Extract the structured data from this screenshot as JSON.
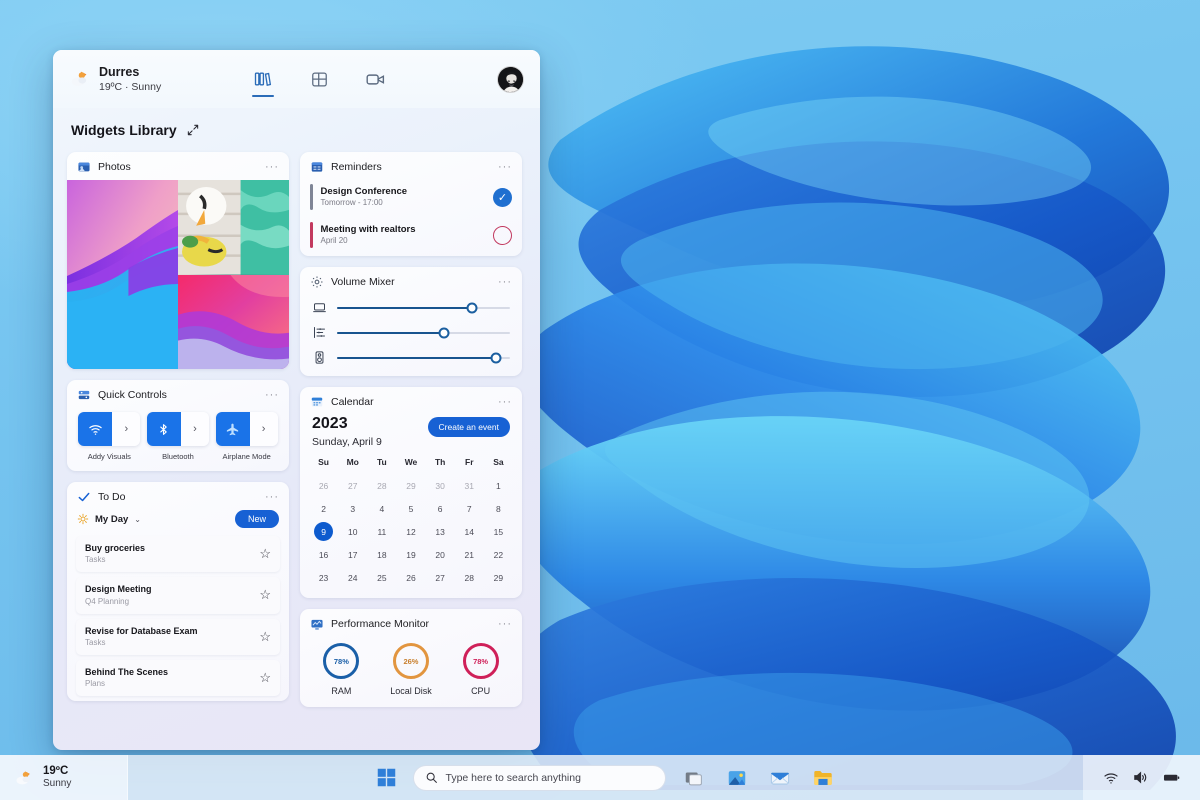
{
  "desktop": {
    "wallpaper_name": "windows-11-bloom-wallpaper"
  },
  "panel": {
    "header": {
      "weather_icon": "sun-behind-cloud-icon",
      "city": "Durres",
      "condition": "19ºC · Sunny",
      "icons": [
        {
          "name": "library-icon",
          "label": "Library",
          "active": true
        },
        {
          "name": "widgets-grid-icon",
          "label": "Widgets",
          "active": false
        },
        {
          "name": "video-camera-icon",
          "label": "Video",
          "active": false
        }
      ],
      "avatar_name": "user-avatar"
    },
    "library": {
      "title": "Widgets Library",
      "expand_icon": "expand-diagonal-icon"
    },
    "widgets": {
      "photos": {
        "icon": "photos-icon",
        "title": "Photos",
        "menu": "···",
        "cells": [
          {
            "name": "photo-tile-1"
          },
          {
            "name": "photo-tile-2"
          },
          {
            "name": "photo-tile-3"
          }
        ]
      },
      "reminders": {
        "icon": "reminders-icon",
        "title": "Reminders",
        "menu": "···",
        "items": [
          {
            "title": "Design Conference",
            "sub": "Tomorrow - 17:00",
            "bar_color": "#7f8596",
            "state": "done",
            "check_glyph": "✓"
          },
          {
            "title": "Meeting with realtors",
            "sub": "April 20",
            "bar_color": "#c2395f",
            "state": "open",
            "check_glyph": ""
          }
        ]
      },
      "volume_mixer": {
        "icon": "volume-mixer-icon",
        "title": "Volume Mixer",
        "menu": "···",
        "sliders": [
          {
            "name": "device-volume-slider",
            "icon": "laptop-icon",
            "value": 78
          },
          {
            "name": "app-volume-slider",
            "icon": "equalizer-icon",
            "value": 62
          },
          {
            "name": "media-volume-slider",
            "icon": "media-device-icon",
            "value": 92
          }
        ]
      },
      "quick_controls": {
        "icon": "quick-controls-icon",
        "title": "Quick Controls",
        "menu": "···",
        "toggles": [
          {
            "name": "wifi-toggle",
            "icon": "wifi-icon",
            "label": "Addy Visuals",
            "arrow": "›"
          },
          {
            "name": "bluetooth-toggle",
            "icon": "bluetooth-icon",
            "label": "Bluetooth",
            "arrow": "›"
          },
          {
            "name": "airplane-toggle",
            "icon": "airplane-icon",
            "label": "Airplane Mode",
            "arrow": "›"
          }
        ]
      },
      "todo": {
        "icon": "checkmark-icon",
        "title": "To Do",
        "menu": "···",
        "list_icon": "sun-icon",
        "list_name": "My Day",
        "chevron": "⌄",
        "new_button": "New",
        "items": [
          {
            "title": "Buy groceries",
            "sub": "Tasks",
            "star": "☆"
          },
          {
            "title": "Design Meeting",
            "sub": "Q4 Planning",
            "star": "☆"
          },
          {
            "title": "Revise for Database Exam",
            "sub": "Tasks",
            "star": "☆"
          },
          {
            "title": "Behind The Scenes",
            "sub": "Plans",
            "star": "☆"
          }
        ]
      },
      "calendar": {
        "icon": "calendar-icon",
        "title": "Calendar",
        "menu": "···",
        "year": "2023",
        "date": "Sunday, April 9",
        "create_button": "Create an event",
        "dow": [
          "Su",
          "Mo",
          "Tu",
          "We",
          "Th",
          "Fr",
          "Sa"
        ],
        "days": [
          {
            "n": "26",
            "muted": true
          },
          {
            "n": "27",
            "muted": true
          },
          {
            "n": "28",
            "muted": true
          },
          {
            "n": "29",
            "muted": true
          },
          {
            "n": "30",
            "muted": true
          },
          {
            "n": "31",
            "muted": true
          },
          {
            "n": "1",
            "muted": false
          },
          {
            "n": "2",
            "muted": false
          },
          {
            "n": "3",
            "muted": false
          },
          {
            "n": "4",
            "muted": false
          },
          {
            "n": "5",
            "muted": false
          },
          {
            "n": "6",
            "muted": false
          },
          {
            "n": "7",
            "muted": false
          },
          {
            "n": "8",
            "muted": false
          },
          {
            "n": "9",
            "muted": false,
            "today": true
          },
          {
            "n": "10",
            "muted": false
          },
          {
            "n": "11",
            "muted": false
          },
          {
            "n": "12",
            "muted": false
          },
          {
            "n": "13",
            "muted": false
          },
          {
            "n": "14",
            "muted": false
          },
          {
            "n": "15",
            "muted": false
          },
          {
            "n": "16",
            "muted": false
          },
          {
            "n": "17",
            "muted": false
          },
          {
            "n": "18",
            "muted": false
          },
          {
            "n": "19",
            "muted": false
          },
          {
            "n": "20",
            "muted": false
          },
          {
            "n": "21",
            "muted": false
          },
          {
            "n": "22",
            "muted": false
          },
          {
            "n": "23",
            "muted": false
          },
          {
            "n": "24",
            "muted": false
          },
          {
            "n": "25",
            "muted": false
          },
          {
            "n": "26",
            "muted": false
          },
          {
            "n": "27",
            "muted": false
          },
          {
            "n": "28",
            "muted": false
          },
          {
            "n": "29",
            "muted": false
          }
        ]
      },
      "performance": {
        "icon": "performance-icon",
        "title": "Performance Monitor",
        "menu": "···",
        "gauges": [
          {
            "name": "ram-gauge",
            "value": "78%",
            "label": "RAM",
            "color": "#1a5fa8",
            "pct": 78
          },
          {
            "name": "disk-gauge",
            "value": "26%",
            "label": "Local Disk",
            "color": "#e2953f",
            "pct": 26
          },
          {
            "name": "cpu-gauge",
            "value": "78%",
            "label": "CPU",
            "color": "#cf2059",
            "pct": 78
          }
        ]
      }
    }
  },
  "taskbar": {
    "weather": {
      "icon": "sun-behind-cloud-icon",
      "temp": "19ºC",
      "cond": "Sunny"
    },
    "start_icon": "windows-start-icon",
    "search": {
      "icon": "search-icon",
      "placeholder": "Type here to search anything",
      "value": ""
    },
    "apps": [
      {
        "name": "task-view-icon"
      },
      {
        "name": "photos-app-icon"
      },
      {
        "name": "mail-app-icon"
      },
      {
        "name": "file-explorer-icon"
      }
    ],
    "tray": [
      {
        "name": "wifi-tray-icon"
      },
      {
        "name": "volume-tray-icon"
      },
      {
        "name": "battery-tray-icon"
      }
    ]
  },
  "colors": {
    "accent": "#1761d4",
    "panel_bg": "#eaf0fa",
    "desktop_blue": "#7ec8f0"
  }
}
